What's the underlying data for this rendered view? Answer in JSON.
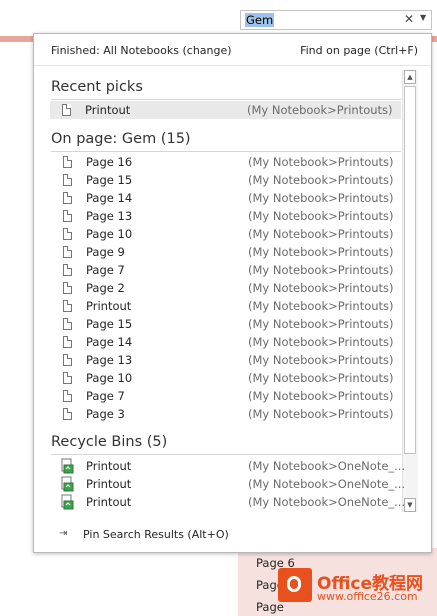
{
  "search": {
    "query": "Gem",
    "clear_glyph": "✕",
    "dropdown_glyph": "▼"
  },
  "header": {
    "status": "Finished:  All Notebooks (change)",
    "find_on_page": "Find on page (Ctrl+F)"
  },
  "sections": {
    "recent": {
      "title": "Recent picks",
      "items": [
        {
          "title": "Printout",
          "location": "(My Notebook>Printouts)"
        }
      ]
    },
    "on_page": {
      "title": "On page:  Gem (15)",
      "items": [
        {
          "title": "Page 16",
          "location": "(My Notebook>Printouts)"
        },
        {
          "title": "Page 15",
          "location": "(My Notebook>Printouts)"
        },
        {
          "title": "Page 14",
          "location": "(My Notebook>Printouts)"
        },
        {
          "title": "Page 13",
          "location": "(My Notebook>Printouts)"
        },
        {
          "title": "Page 10",
          "location": "(My Notebook>Printouts)"
        },
        {
          "title": "Page 9",
          "location": "(My Notebook>Printouts)"
        },
        {
          "title": "Page 7",
          "location": "(My Notebook>Printouts)"
        },
        {
          "title": "Page 2",
          "location": "(My Notebook>Printouts)"
        },
        {
          "title": "Printout",
          "location": "(My Notebook>Printouts)"
        },
        {
          "title": "Page 15",
          "location": "(My Notebook>Printouts)"
        },
        {
          "title": "Page 14",
          "location": "(My Notebook>Printouts)"
        },
        {
          "title": "Page 13",
          "location": "(My Notebook>Printouts)"
        },
        {
          "title": "Page 10",
          "location": "(My Notebook>Printouts)"
        },
        {
          "title": "Page 7",
          "location": "(My Notebook>Printouts)"
        },
        {
          "title": "Page 3",
          "location": "(My Notebook>Printouts)"
        }
      ]
    },
    "recycle": {
      "title": "Recycle Bins (5)",
      "items": [
        {
          "title": "Printout",
          "location": "(My Notebook>OneNote_..."
        },
        {
          "title": "Printout",
          "location": "(My Notebook>OneNote_..."
        },
        {
          "title": "Printout",
          "location": "(My Notebook>OneNote_..."
        }
      ]
    }
  },
  "footer": {
    "pin_label": "Pin Search Results (Alt+O)",
    "pin_glyph": "⇥"
  },
  "background_pages": [
    "Page 6",
    "Page",
    "Page"
  ],
  "watermark": {
    "name": "Office教程网",
    "url": "www.office26.com"
  },
  "colors": {
    "accent": "#e8501e",
    "selection": "#9fc3e8",
    "row_highlight": "#e9e9e9"
  }
}
